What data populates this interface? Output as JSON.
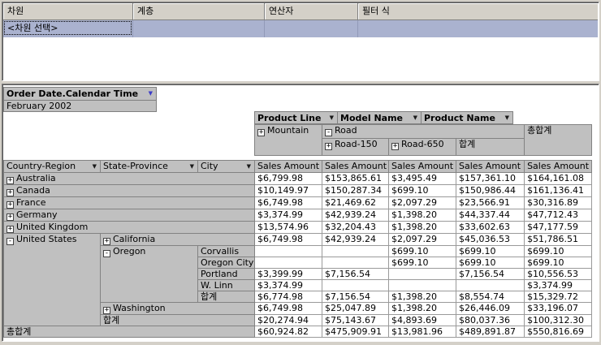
{
  "icons": {
    "expand": "+",
    "collapse": "-",
    "dropdown": "▼"
  },
  "colors": {
    "selection_blue": "#aab2cf",
    "cell_gray": "#c0c0c0",
    "chrome_gray": "#d4d0c8"
  },
  "filter_grid": {
    "headers": [
      {
        "label": "차원"
      },
      {
        "label": "계층"
      },
      {
        "label": "연산자"
      },
      {
        "label": "필터 식"
      }
    ],
    "selected_row": {
      "dimension": "<차원 선택>"
    }
  },
  "pivot": {
    "page_field": {
      "label": "Order Date.Calendar Time",
      "selected_member": "February 2002"
    },
    "column_fields": [
      {
        "label": "Product Line"
      },
      {
        "label": "Model Name"
      },
      {
        "label": "Product Name"
      }
    ],
    "column_headers": {
      "mountain": "Mountain",
      "road": "Road",
      "road_150": "Road-150",
      "road_650": "Road-650",
      "road_total": "합계",
      "grand_total": "총합계"
    },
    "measure": "Sales Amount",
    "row_fields": [
      {
        "label": "Country-Region"
      },
      {
        "label": "State-Province"
      },
      {
        "label": "City"
      }
    ],
    "rows": [
      {
        "label": "Australia",
        "values": [
          "$6,799.98",
          "$153,865.61",
          "$3,495.49",
          "$157,361.10",
          "$164,161.08"
        ]
      },
      {
        "label": "Canada",
        "values": [
          "$10,149.97",
          "$150,287.34",
          "$699.10",
          "$150,986.44",
          "$161,136.41"
        ]
      },
      {
        "label": "France",
        "values": [
          "$6,749.98",
          "$21,469.62",
          "$2,097.29",
          "$23,566.91",
          "$30,316.89"
        ]
      },
      {
        "label": "Germany",
        "values": [
          "$3,374.99",
          "$42,939.24",
          "$1,398.20",
          "$44,337.44",
          "$47,712.43"
        ]
      },
      {
        "label": "United Kingdom",
        "values": [
          "$13,574.96",
          "$32,204.43",
          "$1,398.20",
          "$33,602.63",
          "$47,177.59"
        ]
      },
      {
        "label": "United States"
      },
      {
        "label": "California",
        "values": [
          "$6,749.98",
          "$42,939.24",
          "$2,097.29",
          "$45,036.53",
          "$51,786.51"
        ]
      },
      {
        "label": "Oregon"
      },
      {
        "label": "Corvallis",
        "values": [
          "",
          "",
          "$699.10",
          "$699.10",
          "$699.10"
        ]
      },
      {
        "label": "Oregon City",
        "values": [
          "",
          "",
          "$699.10",
          "$699.10",
          "$699.10"
        ]
      },
      {
        "label": "Portland",
        "values": [
          "$3,399.99",
          "$7,156.54",
          "",
          "$7,156.54",
          "$10,556.53"
        ]
      },
      {
        "label": "W. Linn",
        "values": [
          "$3,374.99",
          "",
          "",
          "",
          "$3,374.99"
        ]
      },
      {
        "label": "합계",
        "values": [
          "$6,774.98",
          "$7,156.54",
          "$1,398.20",
          "$8,554.74",
          "$15,329.72"
        ]
      },
      {
        "label": "Washington",
        "values": [
          "$6,749.98",
          "$25,047.89",
          "$1,398.20",
          "$26,446.09",
          "$33,196.07"
        ]
      },
      {
        "label": "합계",
        "values": [
          "$20,274.94",
          "$75,143.67",
          "$4,893.69",
          "$80,037.36",
          "$100,312.30"
        ]
      },
      {
        "label": "총합계",
        "values": [
          "$60,924.82",
          "$475,909.91",
          "$13,981.96",
          "$489,891.87",
          "$550,816.69"
        ]
      }
    ]
  }
}
